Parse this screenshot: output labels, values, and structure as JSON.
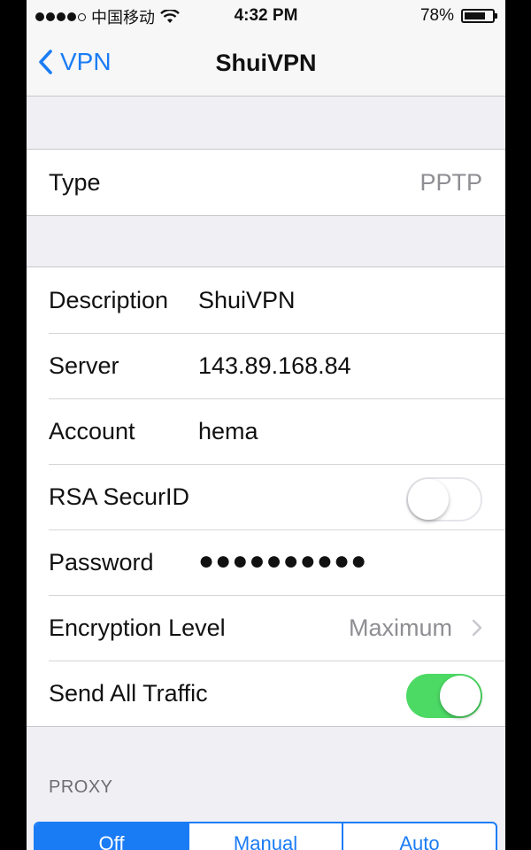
{
  "status_bar": {
    "carrier": "中国移动",
    "time": "4:32 PM",
    "battery": "78%",
    "battery_level": 0.78,
    "signal_icon": "signal-dots-icon",
    "wifi_icon": "wifi-icon",
    "battery_icon": "battery-icon"
  },
  "nav": {
    "back_label": "VPN",
    "title": "ShuiVPN"
  },
  "type_group": {
    "label": "Type",
    "value": "PPTP"
  },
  "config": {
    "description": {
      "label": "Description",
      "value": "ShuiVPN"
    },
    "server": {
      "label": "Server",
      "value": "143.89.168.84"
    },
    "account": {
      "label": "Account",
      "value": "hema"
    },
    "rsa": {
      "label": "RSA SecurID",
      "enabled": false
    },
    "password": {
      "label": "Password",
      "value": "●●●●●●●●●●"
    },
    "encryption": {
      "label": "Encryption Level",
      "value": "Maximum"
    },
    "send_all": {
      "label": "Send All Traffic",
      "enabled": true
    }
  },
  "proxy": {
    "header": "PROXY",
    "options": [
      "Off",
      "Manual",
      "Auto"
    ],
    "selected": "Off"
  },
  "colors": {
    "accent": "#1a7cf5",
    "switch_on": "#4cd964",
    "background": "#efeff4"
  }
}
